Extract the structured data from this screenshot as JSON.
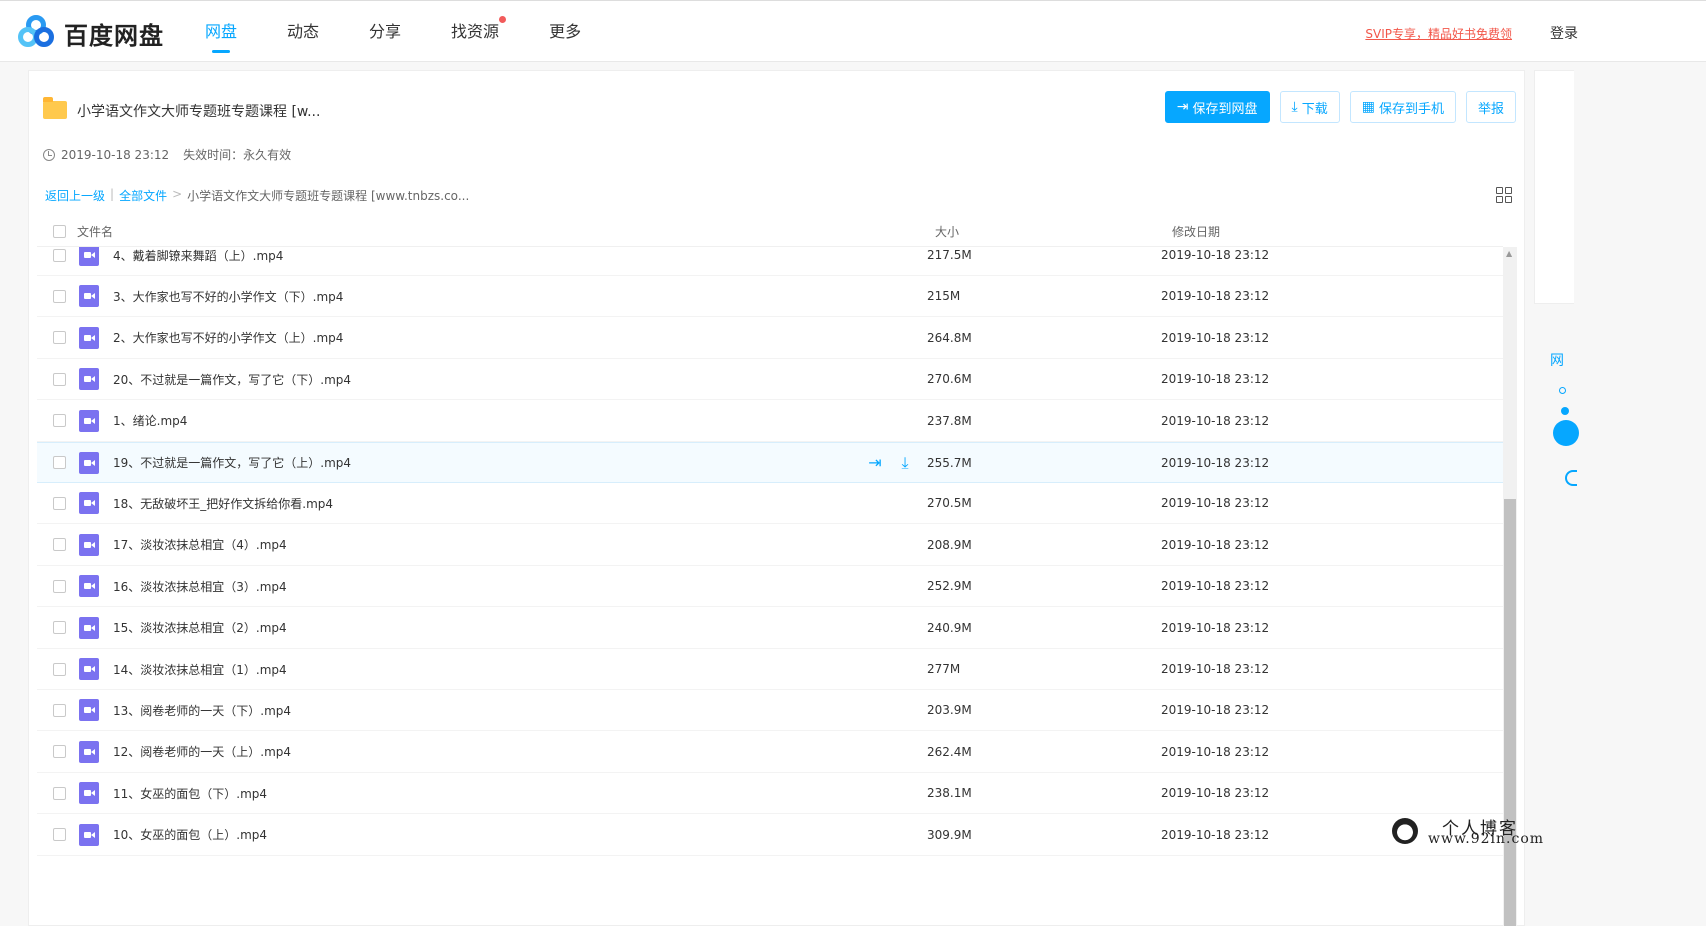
{
  "header": {
    "logo_text": "百度网盘",
    "nav": [
      {
        "label": "网盘",
        "active": true
      },
      {
        "label": "动态",
        "active": false
      },
      {
        "label": "分享",
        "active": false
      },
      {
        "label": "找资源",
        "active": false,
        "badge_dot": true
      },
      {
        "label": "更多",
        "active": false
      }
    ],
    "svip_link": "SVIP专享，精品好书免费领",
    "login": "登录"
  },
  "share": {
    "title": "小学语文作文大师专题班专题课程 [w...",
    "time": "2019-10-18 23:12",
    "expire": "失效时间：永久有效"
  },
  "actions": {
    "save": "保存到网盘",
    "download": "下载",
    "save_phone": "保存到手机",
    "report": "举报"
  },
  "breadcrumb": {
    "back": "返回上一级",
    "all": "全部文件",
    "sep": ">",
    "current": "小学语文作文大师专题班专题课程 [www.tnbzs.co..."
  },
  "table": {
    "headers": {
      "name": "文件名",
      "size": "大小",
      "date": "修改日期"
    },
    "rows": [
      {
        "name": "4、戴着脚镣来舞蹈（上）.mp4",
        "size": "217.5M",
        "date": "2019-10-18 23:12"
      },
      {
        "name": "3、大作家也写不好的小学作文（下）.mp4",
        "size": "215M",
        "date": "2019-10-18 23:12"
      },
      {
        "name": "2、大作家也写不好的小学作文（上）.mp4",
        "size": "264.8M",
        "date": "2019-10-18 23:12"
      },
      {
        "name": "20、不过就是一篇作文，写了它（下）.mp4",
        "size": "270.6M",
        "date": "2019-10-18 23:12"
      },
      {
        "name": "1、绪论.mp4",
        "size": "237.8M",
        "date": "2019-10-18 23:12"
      },
      {
        "name": "19、不过就是一篇作文，写了它（上）.mp4",
        "size": "255.7M",
        "date": "2019-10-18 23:12",
        "hover": true
      },
      {
        "name": "18、无敌破坏王_把好作文拆给你看.mp4",
        "size": "270.5M",
        "date": "2019-10-18 23:12"
      },
      {
        "name": "17、淡妆浓抹总相宜（4）.mp4",
        "size": "208.9M",
        "date": "2019-10-18 23:12"
      },
      {
        "name": "16、淡妆浓抹总相宜（3）.mp4",
        "size": "252.9M",
        "date": "2019-10-18 23:12"
      },
      {
        "name": "15、淡妆浓抹总相宜（2）.mp4",
        "size": "240.9M",
        "date": "2019-10-18 23:12"
      },
      {
        "name": "14、淡妆浓抹总相宜（1）.mp4",
        "size": "277M",
        "date": "2019-10-18 23:12"
      },
      {
        "name": "13、阅卷老师的一天（下）.mp4",
        "size": "203.9M",
        "date": "2019-10-18 23:12"
      },
      {
        "name": "12、阅卷老师的一天（上）.mp4",
        "size": "262.4M",
        "date": "2019-10-18 23:12"
      },
      {
        "name": "11、女巫的面包（下）.mp4",
        "size": "238.1M",
        "date": "2019-10-18 23:12"
      },
      {
        "name": "10、女巫的面包（上）.mp4",
        "size": "309.9M",
        "date": "2019-10-18 23:12"
      }
    ]
  },
  "side": {
    "label": "网"
  },
  "watermark": {
    "line1": "个人博客",
    "line2": "www.92in.com"
  },
  "colors": {
    "accent": "#06a7ff",
    "video_icon": "#7b72f0",
    "svip": "#f2574a",
    "folder": "#ffc94d"
  }
}
